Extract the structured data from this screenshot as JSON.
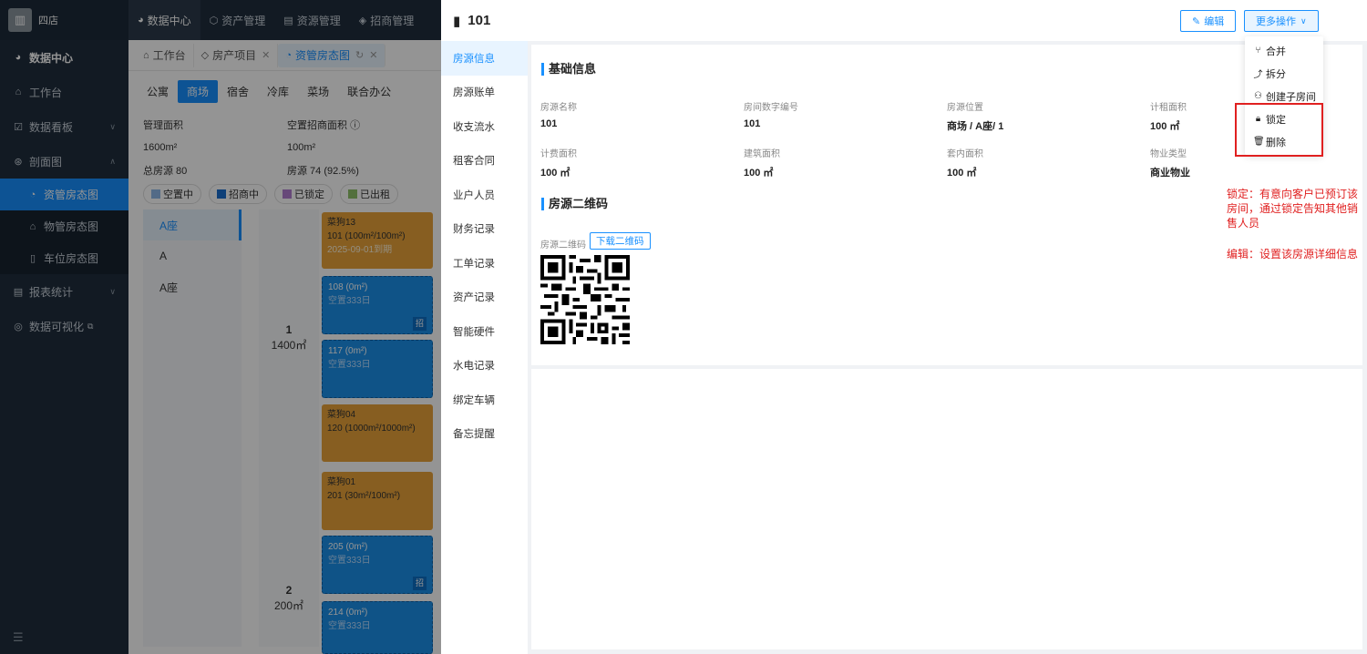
{
  "brand": {
    "name": "四店"
  },
  "sidebar": {
    "items": [
      {
        "label": "数据中心",
        "icon": "pie-icon"
      },
      {
        "label": "工作台",
        "icon": "home-icon"
      },
      {
        "label": "数据看板",
        "icon": "board-icon"
      },
      {
        "label": "剖面图",
        "icon": "section-icon"
      },
      {
        "label": "报表统计",
        "icon": "report-icon"
      },
      {
        "label": "数据可视化",
        "icon": "visual-icon"
      }
    ],
    "sub_items": [
      {
        "label": "资管房态图"
      },
      {
        "label": "物管房态图"
      },
      {
        "label": "车位房态图"
      }
    ]
  },
  "topnav": {
    "items": [
      "数据中心",
      "资产管理",
      "资源管理",
      "招商管理"
    ]
  },
  "tabs": {
    "items": [
      "工作台",
      "房产项目",
      "资管房态图"
    ]
  },
  "bg": {
    "categories": [
      "公寓",
      "商场",
      "宿舍",
      "冷库",
      "菜场",
      "联合办公"
    ],
    "stats": {
      "mgmt_area_label": "管理面积",
      "vacant_area_label": "空置招商面积",
      "mgmt_area_value": "1600m²",
      "vacant_area_value": "100m²",
      "total_rooms": "总房源 80",
      "rooms_pct": "房源 74 (92.5%)"
    },
    "legend": [
      {
        "label": "空置中",
        "color": "#8fb8e8"
      },
      {
        "label": "招商中",
        "color": "#1a6fcf"
      },
      {
        "label": "已锁定",
        "color": "#b27fd0"
      },
      {
        "label": "已出租",
        "color": "#8fc26a"
      }
    ],
    "buildings": [
      "A座",
      "A",
      "A座"
    ],
    "floors": [
      {
        "num": "1",
        "area": "1400㎡"
      },
      {
        "num": "2",
        "area": "200㎡"
      }
    ],
    "rooms": [
      {
        "name": "菜狗13",
        "info": "101 (100m²/100m²)",
        "sub": "2025-09-01到期"
      },
      {
        "name": "108 (0m²)",
        "sub": "空置333日",
        "tag": "招"
      },
      {
        "name": "117 (0m²)",
        "sub": "空置333日"
      },
      {
        "name": "菜狗04",
        "info": "120 (1000m²/1000m²)"
      },
      {
        "name": "菜狗01",
        "info": "201 (30m²/100m²)"
      },
      {
        "name": "205 (0m²)",
        "sub": "空置333日",
        "tag": "招"
      },
      {
        "name": "214 (0m²)",
        "sub": "空置333日"
      }
    ]
  },
  "drawer": {
    "title": "101",
    "edit_label": "编辑",
    "more_label": "更多操作",
    "nav": [
      "房源信息",
      "房源账单",
      "收支流水",
      "租客合同",
      "业户人员",
      "财务记录",
      "工单记录",
      "资产记录",
      "智能硬件",
      "水电记录",
      "绑定车辆",
      "备忘提醒"
    ],
    "basic_title": "基础信息",
    "fields": [
      {
        "label": "房源名称",
        "value": "101"
      },
      {
        "label": "房间数字编号",
        "value": "101"
      },
      {
        "label": "房源位置",
        "value": "商场 / A座/ 1"
      },
      {
        "label": "计租面积",
        "value": "100 ㎡"
      },
      {
        "label": "计费面积",
        "value": "100 ㎡"
      },
      {
        "label": "建筑面积",
        "value": "100 ㎡"
      },
      {
        "label": "套内面积",
        "value": "100 ㎡"
      },
      {
        "label": "物业类型",
        "value": "商业物业"
      }
    ],
    "qr_title": "房源二维码",
    "qr_label": "房源二维码",
    "qr_download": "下载二维码"
  },
  "dropdown": {
    "items": [
      {
        "label": "合并",
        "icon": "merge-icon"
      },
      {
        "label": "拆分",
        "icon": "split-icon"
      },
      {
        "label": "创建子房间",
        "icon": "create-subroom-icon"
      },
      {
        "label": "锁定",
        "icon": "lock-icon"
      },
      {
        "label": "删除",
        "icon": "trash-icon"
      }
    ]
  },
  "annotations": {
    "lock": "锁定：有意向客户已预订该房间，通过锁定告知其他销售人员",
    "edit": "编辑：设置该房源详细信息"
  },
  "colors": {
    "accent": "#1890ff",
    "sidebar": "#1f2d3d",
    "annotation": "#e02020"
  }
}
